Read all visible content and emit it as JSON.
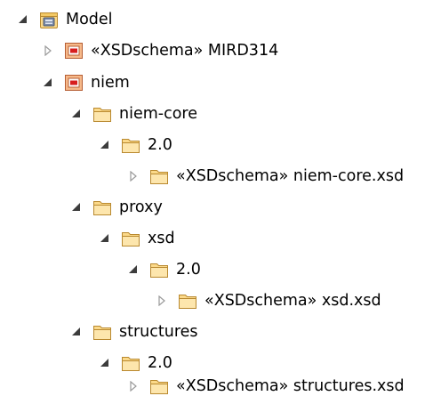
{
  "tree": {
    "model": {
      "label": "Model"
    },
    "mird314": {
      "label": "«XSDschema» MIRD314"
    },
    "niem": {
      "label": "niem"
    },
    "niem_core": {
      "label": "niem-core"
    },
    "niem_core_20": {
      "label": "2.0"
    },
    "niem_core_xsd": {
      "label": "«XSDschema» niem-core.xsd"
    },
    "proxy": {
      "label": "proxy"
    },
    "xsd": {
      "label": "xsd"
    },
    "xsd_20": {
      "label": "2.0"
    },
    "xsd_xsd": {
      "label": "«XSDschema» xsd.xsd"
    },
    "structures": {
      "label": "structures"
    },
    "structures_20": {
      "label": "2.0"
    },
    "structures_xsd": {
      "label": "«XSDschema» structures.xsd"
    }
  },
  "icons": {
    "expanded": "triangle-expanded-icon",
    "collapsed": "triangle-collapsed-icon",
    "model": "model-package-icon",
    "schema": "schema-package-icon",
    "folder": "folder-icon"
  },
  "colors": {
    "folder_fill": "#fbd98a",
    "folder_stroke": "#b9892f",
    "schema_fill": "#f6b98a",
    "schema_stroke": "#b65e34",
    "schema_inner": "#d71e1e",
    "toggle_expanded": "#3c3c3c",
    "toggle_collapsed": "#9a9a9a"
  }
}
